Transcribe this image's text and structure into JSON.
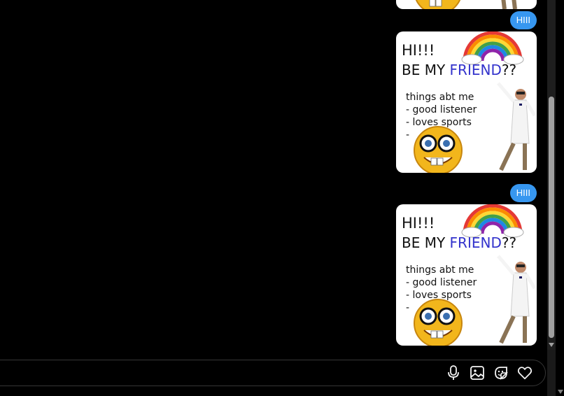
{
  "messages": [
    {
      "type": "text",
      "text": "HIII"
    },
    {
      "type": "text",
      "text": "HIII"
    }
  ],
  "meme": {
    "line1": "HI!!!",
    "line2_prefix": "BE MY ",
    "line2_highlight": "FRIEND",
    "line2_suffix": "??",
    "list_title": "things abt me",
    "item1": "- good listener",
    "item2": "- loves sports",
    "item3": "-"
  },
  "composer": {
    "icons": [
      "microphone-icon",
      "image-icon",
      "sticker-icon",
      "heart-icon"
    ]
  },
  "colors": {
    "bubble": "#3797f0",
    "background": "#000000",
    "friend_text": "#3333cc"
  }
}
